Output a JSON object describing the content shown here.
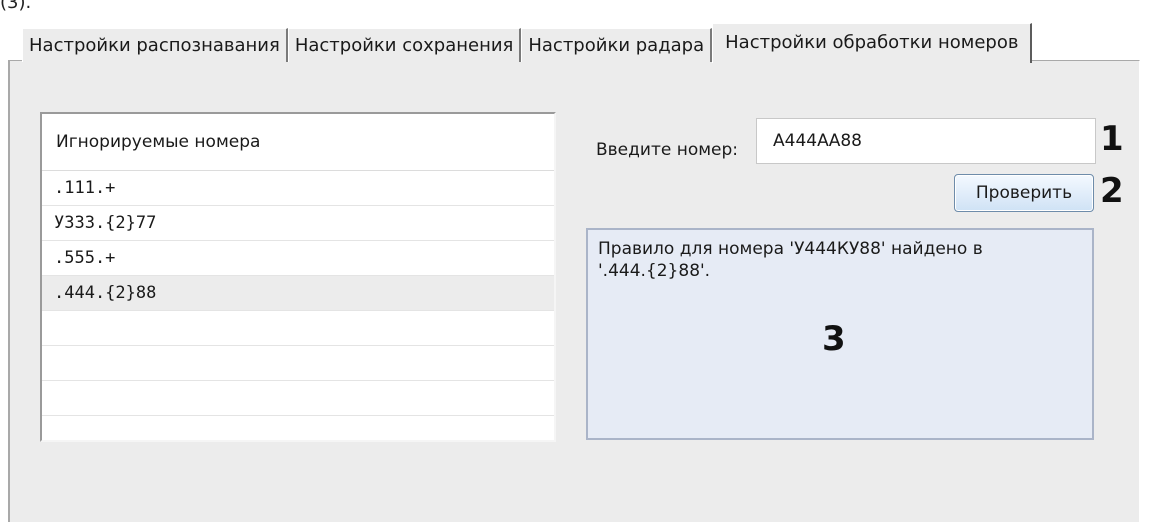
{
  "top_cropped_text": "(3).",
  "tabs": [
    {
      "label": "Настройки распознавания",
      "active": false
    },
    {
      "label": "Настройки сохранения",
      "active": false
    },
    {
      "label": "Настройки радара",
      "active": false
    },
    {
      "label": "Настройки обработки номеров",
      "active": true
    }
  ],
  "ignored_list": {
    "header": "Игнорируемые номера",
    "items": [
      ".111.+",
      "У333.{2}77",
      ".555.+",
      ".444.{2}88"
    ],
    "selected_index": 3,
    "empty_rows": 4
  },
  "number_input": {
    "label": "Введите номер:",
    "value": "А444АА88"
  },
  "check_button": {
    "label": "Проверить"
  },
  "result_text": "Правило для номера 'У444КУ88' найдено в\n'.444.{2}88'.",
  "callouts": {
    "one": "1",
    "two": "2",
    "three": "3"
  }
}
